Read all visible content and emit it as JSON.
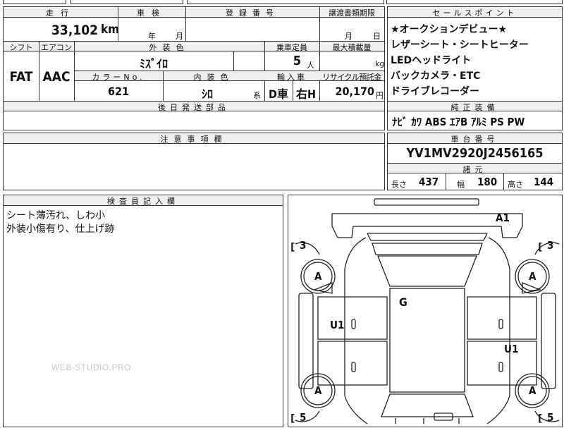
{
  "top_row": {
    "hdr_mileage": "走行",
    "hdr_inspection": "車検",
    "hdr_registration": "登録番号",
    "hdr_transfer_deadline": "譲渡書類期限",
    "hdr_sales_point": "セールスポイント"
  },
  "mileage": {
    "value": "33,102",
    "unit": "km"
  },
  "inspection": {
    "year_label": "年",
    "month_label": "月"
  },
  "transfer": {
    "month_label": "月",
    "day_label": "日"
  },
  "sales_points": [
    "★オークションデビュー★",
    "レザーシート・シートヒーター",
    "LEDヘッドライト",
    "バックカメラ・ETC",
    "ドライブレコーダー"
  ],
  "row2_headers": {
    "shift": "シフト",
    "aircon": "エアコン",
    "exterior_color": "外装色",
    "capacity": "乗車定員",
    "max_load": "最大積載量"
  },
  "shift": "FAT",
  "aircon": "AAC",
  "exterior_color": "ﾐｽﾞｲﾛ",
  "capacity": {
    "value": "5",
    "unit": "人"
  },
  "max_load": {
    "unit": "kg"
  },
  "row3_headers": {
    "color_no": "カラーNo.",
    "interior_color": "内装色",
    "import": "輸入車",
    "recycle": "リサイクル預託金"
  },
  "color_no": "621",
  "interior_color": {
    "value": "ｼﾛ",
    "suffix": "系"
  },
  "import_type": {
    "d": "D車",
    "hand": "右H"
  },
  "recycle": {
    "value": "20,170",
    "unit": "円"
  },
  "later_parts_header": "後日発送部品",
  "equipment": {
    "header": "純正装備",
    "items": "ﾅﾋﾞ ｶﾜ ABS ｴｱB ｱﾙﾐ PS PW"
  },
  "notes_header": "注意事項欄",
  "chassis": {
    "header": "車台番号",
    "value": "YV1MV2920J2456165"
  },
  "dims": {
    "header": "諸元",
    "length_label": "長さ",
    "length": "437",
    "width_label": "幅",
    "width": "180",
    "height_label": "高さ",
    "height": "144"
  },
  "inspector": {
    "header": "検査員記入欄",
    "comments": [
      "シート薄汚れ、しわ小",
      "外装小傷有り、仕上げ跡"
    ]
  },
  "watermark": "WEB-STUDIO.PRO",
  "diagram_marks": {
    "top_right": "A1",
    "left_upper_bracket": "3",
    "right_upper_bracket": "3",
    "left_lower_bracket": "5",
    "right_lower_bracket": "5",
    "wheel": "A",
    "roof": "G",
    "left_door": "U1",
    "right_door": "U1"
  }
}
